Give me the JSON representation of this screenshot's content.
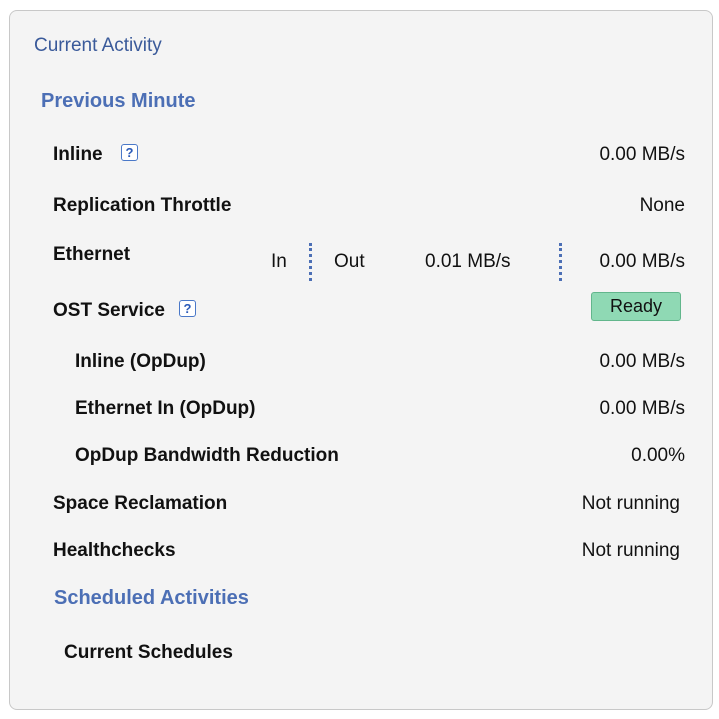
{
  "panel": {
    "title": "Current Activity",
    "previous_minute": {
      "heading": "Previous Minute",
      "inline": {
        "label": "Inline",
        "help": "?",
        "value": "0.00 MB/s"
      },
      "replication_throttle": {
        "label": "Replication Throttle",
        "value": "None"
      },
      "ethernet": {
        "label": "Ethernet",
        "in_label": "In",
        "out_label": "Out",
        "in_value": "0.01 MB/s",
        "out_value": "0.00 MB/s"
      },
      "ost_service": {
        "label": "OST Service",
        "help": "?",
        "status": "Ready",
        "status_color": "#8fd9b4"
      },
      "inline_opdup": {
        "label": "Inline (OpDup)",
        "value": "0.00 MB/s"
      },
      "ethernet_in_opdup": {
        "label": "Ethernet In (OpDup)",
        "value": "0.00 MB/s"
      },
      "opdup_bandwidth_reduction": {
        "label": "OpDup Bandwidth Reduction",
        "value": "0.00%"
      },
      "space_reclamation": {
        "label": "Space Reclamation",
        "value": "Not running"
      },
      "healthchecks": {
        "label": "Healthchecks",
        "value": "Not running"
      }
    },
    "scheduled_activities": {
      "heading": "Scheduled Activities",
      "current_schedules_label": "Current Schedules"
    }
  },
  "colors": {
    "heading": "#4c6fb5",
    "panel_background": "#f4f4f4",
    "help_icon": "#2a5ab8"
  },
  "icons": [
    "help-icon"
  ]
}
